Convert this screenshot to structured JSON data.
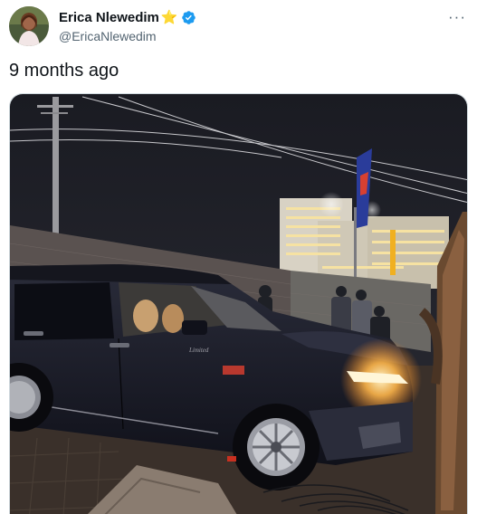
{
  "author": {
    "display_name": "Erica Nlewedim",
    "handle": "@EricaNlewedim",
    "badge_emoji": "⭐",
    "verified": true,
    "avatar_icon": "avatar"
  },
  "post": {
    "text": "9 months ago",
    "more_icon": "more-options-icon",
    "more_glyph": "···"
  },
  "media": {
    "type": "photo",
    "car_badge_text": "Limited"
  },
  "colors": {
    "verified_blue": "#1d9bf0",
    "text_primary": "#0f1419",
    "text_secondary": "#536471"
  }
}
